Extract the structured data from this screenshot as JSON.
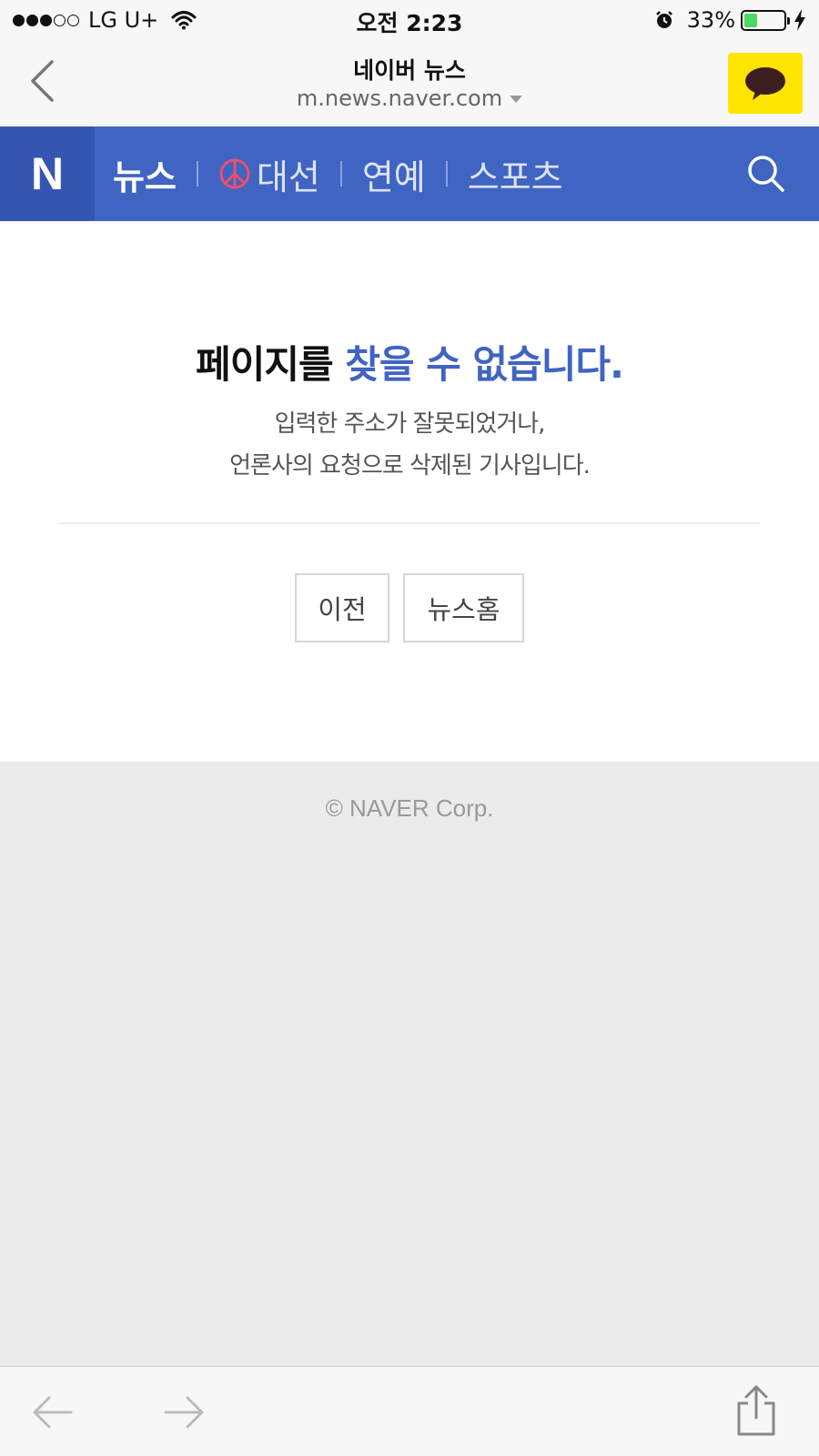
{
  "status_bar": {
    "carrier": "LG U+",
    "time": "오전 2:23",
    "battery_percent": "33%",
    "battery_level": 0.33
  },
  "browser": {
    "site_title": "네이버 뉴스",
    "url": "m.news.naver.com"
  },
  "nav": {
    "logo": "N",
    "items": [
      {
        "label": "뉴스",
        "active": true
      },
      {
        "label": "대선",
        "icon": "peace-icon"
      },
      {
        "label": "연예"
      },
      {
        "label": "스포츠"
      }
    ]
  },
  "error": {
    "title_prefix": "페이지를 ",
    "title_accent": "찾을 수 없습니다.",
    "desc_line1": "입력한 주소가 잘못되었거나,",
    "desc_line2": "언론사의 요청으로 삭제된 기사입니다.",
    "prev_button": "이전",
    "home_button": "뉴스홈"
  },
  "footer": {
    "copyright": "© NAVER Corp."
  },
  "colors": {
    "brand_blue": "#4064c2",
    "kakao_yellow": "#ffe400",
    "battery_green": "#4cd964"
  }
}
